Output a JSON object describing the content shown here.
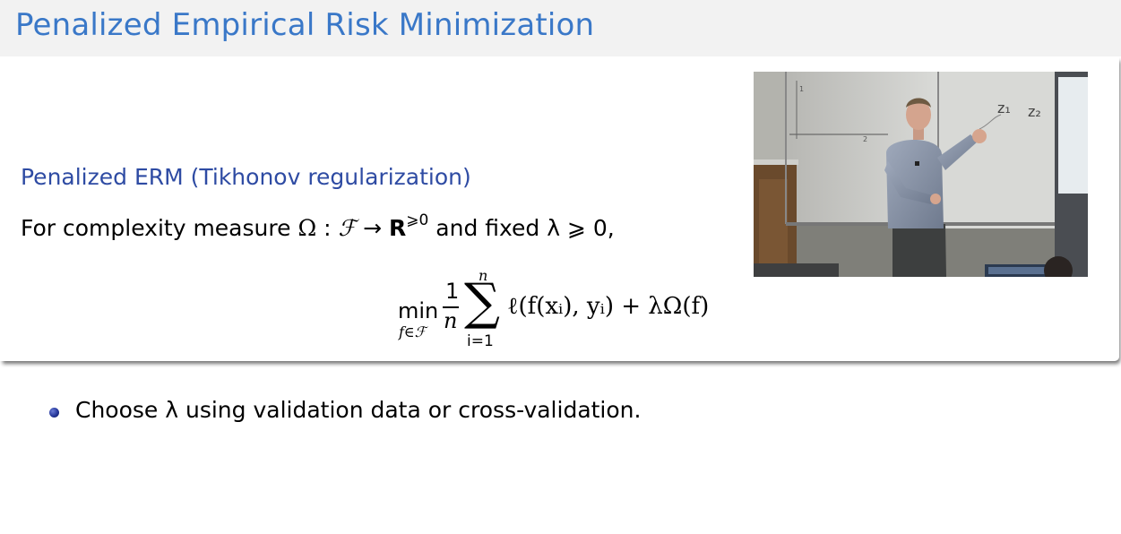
{
  "slide": {
    "title": "Penalized Empirical Risk Minimization"
  },
  "block": {
    "title": "Penalized ERM (Tikhonov regularization)",
    "line_prefix": "For complexity measure ",
    "omega": "Ω",
    "colon": " : ",
    "calF": "ℱ",
    "arrow": " → ",
    "reals": "R",
    "reals_sup": "⩾0",
    "line_suffix": " and fixed λ ⩾ 0,",
    "eq_min": "min",
    "eq_min_sub": "f∈ℱ",
    "eq_frac_num": "1",
    "eq_frac_den": "n",
    "eq_sum": "∑",
    "eq_sum_top": "n",
    "eq_sum_bot": "i=1",
    "eq_body": "ℓ(f(xᵢ), yᵢ) + λΩ(f)"
  },
  "video": {
    "board_marks": [
      "1",
      "z₁",
      "z₂",
      "2"
    ]
  },
  "bullets": [
    {
      "text": "Choose λ using validation data or cross-validation."
    }
  ]
}
